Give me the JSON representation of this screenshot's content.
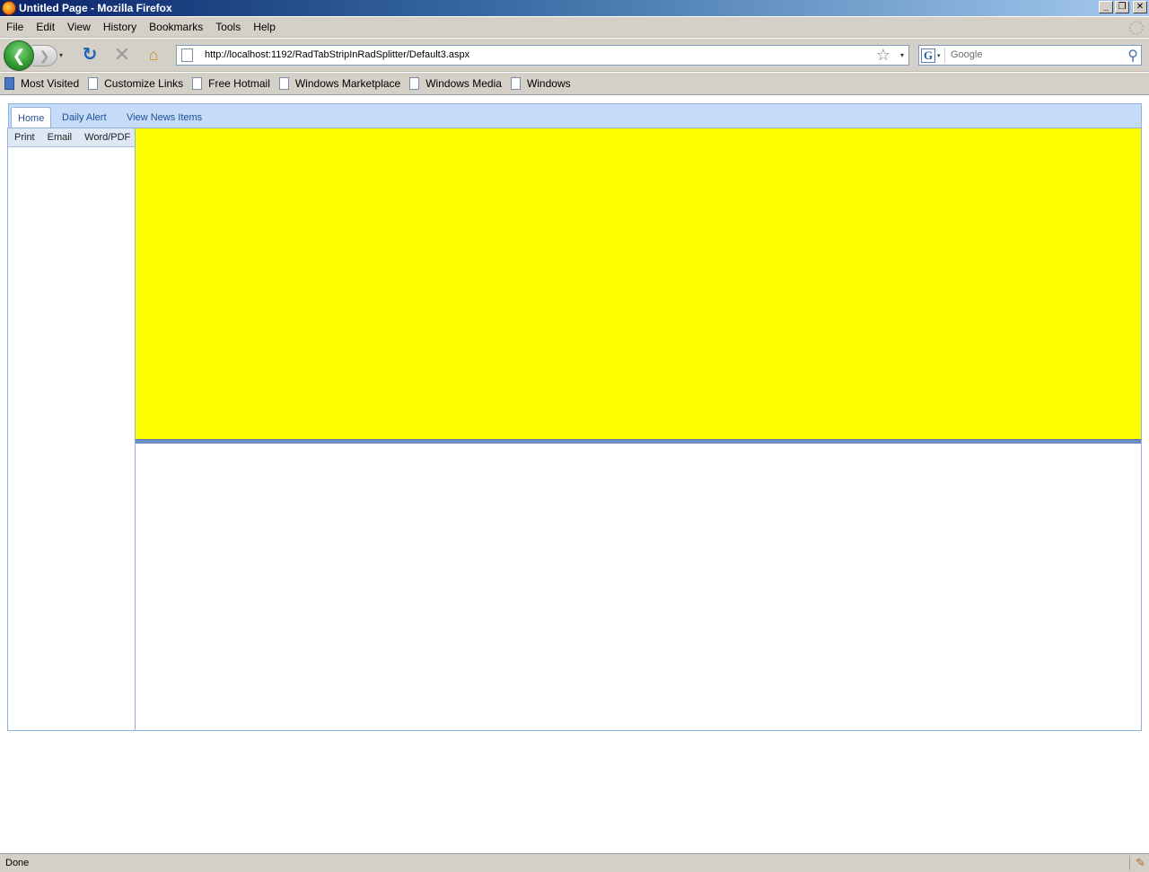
{
  "window": {
    "title": "Untitled Page - Mozilla Firefox",
    "controls": {
      "minimize": "_",
      "restore": "❐",
      "close": "✕"
    }
  },
  "menu": {
    "items": [
      "File",
      "Edit",
      "View",
      "History",
      "Bookmarks",
      "Tools",
      "Help"
    ]
  },
  "nav": {
    "back": "❮",
    "forward": "❯",
    "history_dropdown": "▾",
    "reload": "↻",
    "stop": "✕",
    "home": "⌂",
    "url": "http://localhost:1192/RadTabStripInRadSplitter/Default3.aspx",
    "star": "☆",
    "url_dropdown": "▾"
  },
  "search": {
    "engine_letter": "G",
    "engine_dropdown": "▾",
    "placeholder": "Google",
    "icon": "⚲"
  },
  "bookmarks": {
    "items": [
      "Most Visited",
      "Customize Links",
      "Free Hotmail",
      "Windows Marketplace",
      "Windows Media",
      "Windows"
    ]
  },
  "page": {
    "tabs": [
      "Home",
      "Daily Alert",
      "View News Items"
    ],
    "selected_tab": "Home",
    "subtabs": [
      "Print",
      "Email",
      "Word/PDF"
    ],
    "colors": {
      "top_pane": "#ffff00",
      "tab_text": "#1f4e97",
      "tabstrip_bg": "#c5dbf7",
      "split_bar": "#6b8fc3"
    }
  },
  "status": {
    "text": "Done",
    "addon_icon": "✎"
  }
}
